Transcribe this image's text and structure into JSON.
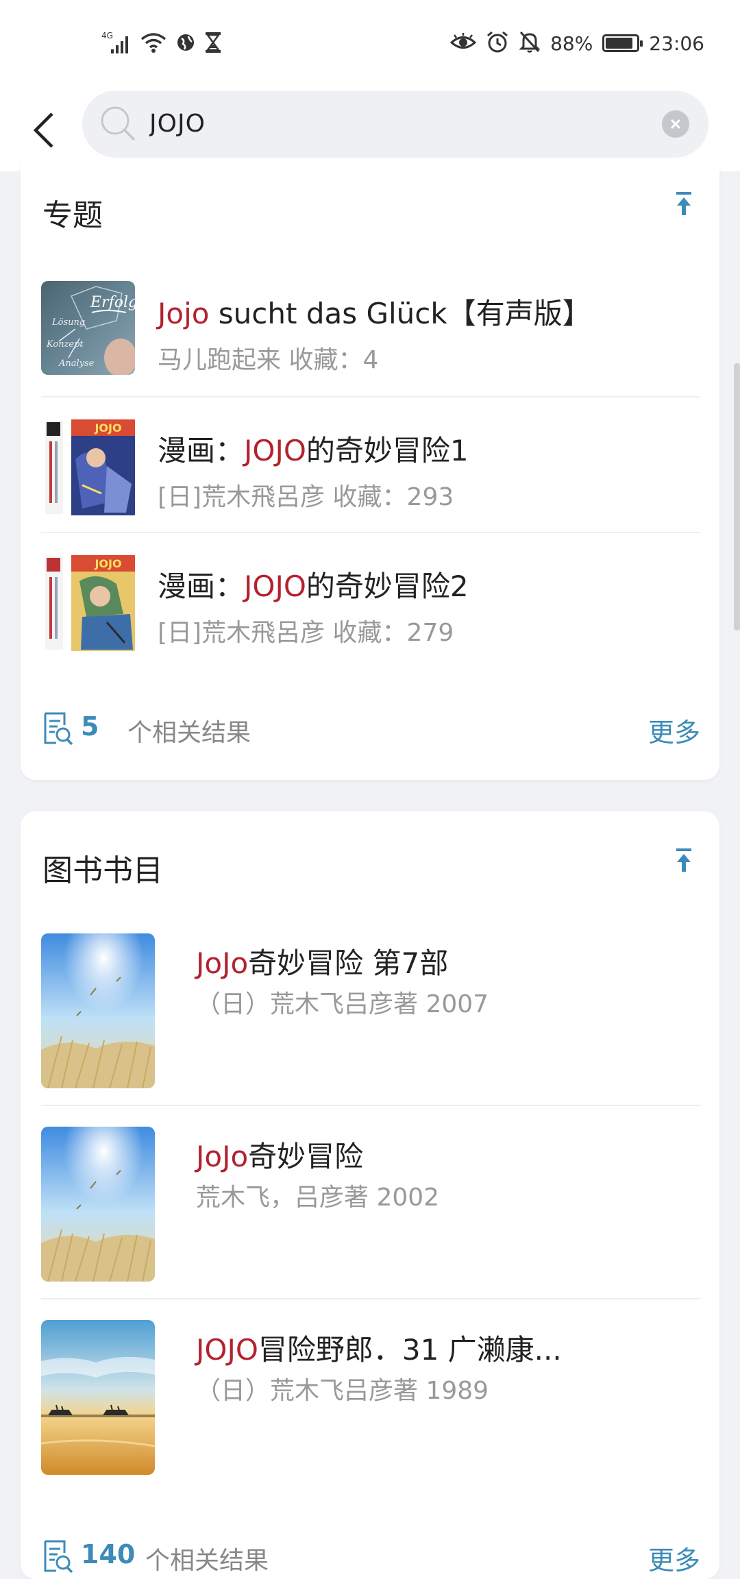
{
  "status_bar": {
    "network": "4G",
    "battery_percent": "88%",
    "battery_level": 0.88,
    "time": "23:06"
  },
  "search": {
    "query": "JOJO"
  },
  "topics": {
    "title": "专题",
    "items": [
      {
        "hl": "Jojo",
        "rest": " sucht das Glück【有声版】",
        "sub": "马儿跑起来 收藏：4",
        "thumb_text": "Erfolg"
      },
      {
        "hl": "JOJO",
        "pre": "漫画：",
        "rest": "的奇妙冒险1",
        "sub": "[日]荒木飛呂彦 收藏：293"
      },
      {
        "hl": "JOJO",
        "pre": "漫画：",
        "rest": "的奇妙冒险2",
        "sub": "[日]荒木飛呂彦 收藏：279"
      }
    ],
    "count": "5",
    "count_label": "个相关结果",
    "more": "更多"
  },
  "books": {
    "title": "图书书目",
    "items": [
      {
        "hl": "JoJo",
        "rest": "奇妙冒险 第7部",
        "sub": "（日）荒木飞吕彦著   2007"
      },
      {
        "hl": "JoJo",
        "rest": "奇妙冒险",
        "sub": "荒木飞，吕彦著   2002"
      },
      {
        "hl": "JOJO",
        "rest": "冒险野郎．31 广濑康...",
        "sub": "（日）荒木飞吕彦著   1989"
      }
    ],
    "count": "140",
    "count_label": "个相关结果",
    "more": "更多"
  },
  "colors": {
    "highlight": "#b3222f",
    "accent": "#3d8bb8",
    "background": "#f1f2f6"
  }
}
